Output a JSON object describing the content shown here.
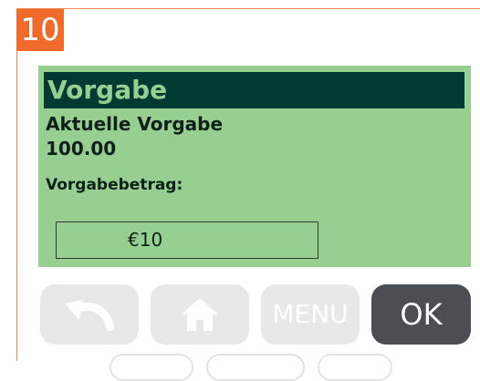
{
  "step": {
    "number": "10"
  },
  "screen": {
    "title": "Vorgabe",
    "current_label": "Aktuelle Vorgabe",
    "current_value": "100.00",
    "amount_label": "Vorgabebetrag:",
    "amount_value": "€10"
  },
  "buttons": {
    "back_icon": "undo-arrow-icon",
    "home_icon": "home-icon",
    "menu_label": "MENU",
    "ok_label": "OK"
  },
  "colors": {
    "accent": "#ef6a2b",
    "screen_bg": "#97cf91",
    "title_bg": "#003a33",
    "ok_bg": "#4b4f52",
    "key_bg": "#e8e8e8"
  }
}
